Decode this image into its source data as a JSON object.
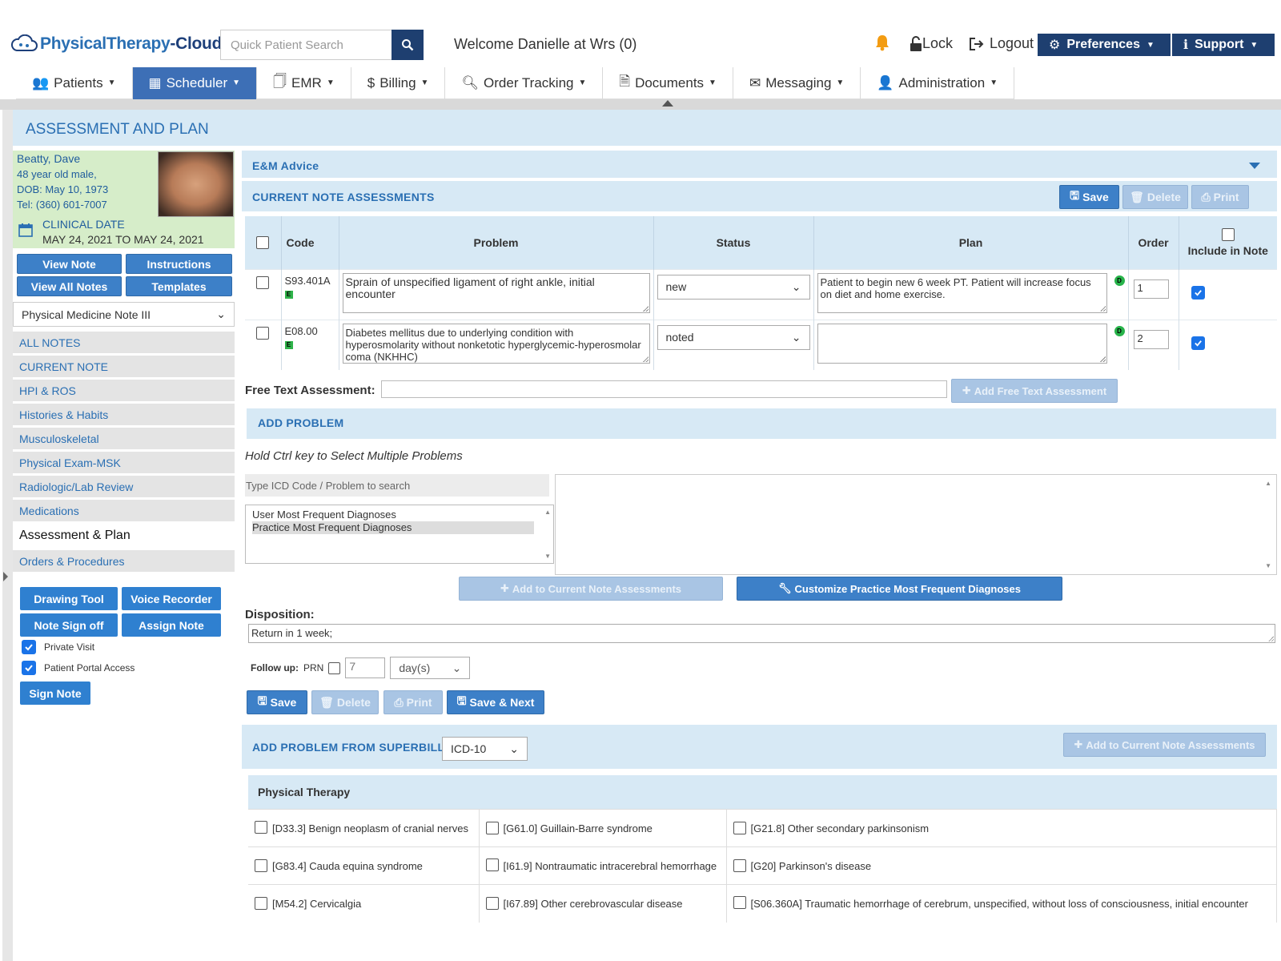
{
  "header": {
    "brand_part1": "PhysicalTherapy",
    "brand_part2": "-Cloud",
    "search_placeholder": "Quick Patient Search",
    "welcome": "Welcome Danielle at Wrs (0)",
    "lock": "Lock",
    "logout": "Logout",
    "preferences": "Preferences",
    "support": "Support"
  },
  "nav": {
    "items": [
      {
        "label": "Patients",
        "icon": "users-icon"
      },
      {
        "label": "Scheduler",
        "icon": "calendar-icon"
      },
      {
        "label": "EMR",
        "icon": "document-icon"
      },
      {
        "label": "Billing",
        "icon": "dollar-icon"
      },
      {
        "label": "Order Tracking",
        "icon": "search-icon"
      },
      {
        "label": "Documents",
        "icon": "file-icon"
      },
      {
        "label": "Messaging",
        "icon": "envelope-icon"
      },
      {
        "label": "Administration",
        "icon": "user-icon"
      }
    ],
    "active": "Scheduler"
  },
  "page_title": "ASSESSMENT AND PLAN",
  "patient": {
    "name": "Beatty, Dave",
    "age": "48 year old male,",
    "dob": "DOB: May 10, 1973",
    "tel": "Tel: (360) 601-7007",
    "clinical_label": "CLINICAL DATE",
    "clinical_range": "MAY 24, 2021 TO MAY 24, 2021"
  },
  "left_buttons": {
    "view_note": "View Note",
    "instructions": "Instructions",
    "view_all_notes": "View All Notes",
    "templates": "Templates"
  },
  "note_type": "Physical Medicine Note III",
  "sidebar": {
    "items": [
      "ALL NOTES",
      "CURRENT NOTE",
      "HPI & ROS",
      "Histories & Habits",
      "Musculoskeletal",
      "Physical Exam-MSK",
      "Radiologic/Lab Review",
      "Medications",
      "Assessment & Plan",
      "Orders & Procedures"
    ]
  },
  "tools": {
    "drawing_tool": "Drawing Tool",
    "voice_recorder": "Voice Recorder",
    "note_sign_off": "Note Sign off",
    "assign_note": "Assign Note",
    "private_visit": "Private Visit",
    "patient_portal": "Patient Portal Access",
    "sign_note": "Sign Note"
  },
  "em_advice": "E&M Advice",
  "current_assessments": {
    "title": "CURRENT NOTE ASSESSMENTS",
    "save": "Save",
    "delete": "Delete",
    "print": "Print",
    "columns": [
      "Code",
      "Problem",
      "Status",
      "Plan",
      "Order",
      "Include in Note"
    ],
    "rows": [
      {
        "code": "S93.401A",
        "badge": "E",
        "problem": "Sprain of unspecified ligament of right ankle, initial encounter",
        "status": "new",
        "plan": "Patient to begin new 6 week PT.  Patient will increase focus on diet and home exercise.",
        "plan_badge": "D",
        "order": "1",
        "include": true
      },
      {
        "code": "E08.00",
        "badge": "E",
        "problem": "Diabetes mellitus due to underlying condition with hyperosmolarity without nonketotic hyperglycemic-hyperosmolar coma (NKHHC)",
        "status": "noted",
        "plan": "",
        "plan_badge": "D",
        "order": "2",
        "include": true
      }
    ]
  },
  "free_text": {
    "label": "Free Text Assessment:",
    "button": "Add Free Text Assessment"
  },
  "add_problem": {
    "title": "ADD PROBLEM",
    "hint": "Hold Ctrl key to Select Multiple Problems",
    "search_placeholder": "Type ICD Code / Problem to search",
    "list": [
      "User Most Frequent Diagnoses",
      "Practice Most Frequent Diagnoses"
    ],
    "add_button": "Add to Current Note Assessments",
    "customize_button": "Customize Practice Most Frequent Diagnoses"
  },
  "disposition": {
    "label": "Disposition:",
    "value": "Return in 1 week;"
  },
  "follow_up": {
    "label": "Follow up:",
    "prn": "PRN",
    "value": "7",
    "unit": "day(s)"
  },
  "bottom_buttons": {
    "save": "Save",
    "delete": "Delete",
    "print": "Print",
    "save_next": "Save & Next"
  },
  "superbill": {
    "title": "ADD PROBLEM FROM SUPERBILL",
    "code_set": "ICD-10",
    "add_button": "Add to Current Note Assessments",
    "section": "Physical Therapy",
    "cells": [
      [
        "[D33.3] Benign neoplasm of cranial nerves",
        "[G61.0] Guillain-Barre syndrome",
        "[G21.8] Other secondary parkinsonism"
      ],
      [
        "[G83.4] Cauda equina syndrome",
        "[I61.9] Nontraumatic intracerebral hemorrhage",
        "[G20] Parkinson's disease"
      ],
      [
        "[M54.2] Cervicalgia",
        "[I67.89] Other cerebrovascular disease",
        "[S06.360A] Traumatic hemorrhage of cerebrum, unspecified, without loss of consciousness, initial encounter"
      ]
    ]
  },
  "colors": {
    "primary": "#3d80c8",
    "navy": "#1e3f70",
    "panel_blue": "#d7e9f5",
    "patient_green": "#d6edc9"
  }
}
